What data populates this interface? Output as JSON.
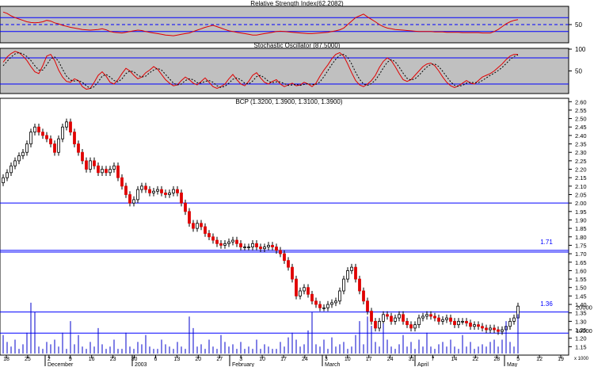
{
  "chart_data": [
    {
      "type": "line",
      "title": "Relative Strength Index(62.2082)",
      "ylim": [
        0,
        100
      ],
      "y_ticks": [
        50
      ],
      "levels": [
        70,
        50,
        30
      ],
      "series": [
        {
          "color": "#e00000",
          "values": [
            86,
            82,
            75,
            70,
            66,
            62,
            58,
            56,
            55,
            56,
            58,
            62,
            60,
            55,
            52,
            48,
            45,
            42,
            40,
            38,
            36,
            35,
            34,
            35,
            36,
            38,
            35,
            30,
            28,
            27,
            26,
            28,
            30,
            32,
            34,
            33,
            30,
            28,
            26,
            24,
            22,
            20,
            19,
            18,
            20,
            22,
            24,
            26,
            30,
            34,
            38,
            42,
            45,
            48,
            44,
            40,
            36,
            32,
            30,
            28,
            26,
            24,
            22,
            20,
            20,
            22,
            24,
            26,
            28,
            30,
            31,
            30,
            29,
            28,
            27,
            26,
            25,
            24,
            24,
            25,
            26,
            27,
            28,
            30,
            32,
            35,
            40,
            50,
            60,
            70,
            75,
            80,
            72,
            65,
            58,
            50,
            44,
            40,
            38,
            36,
            35,
            34,
            33,
            32,
            31,
            30,
            30,
            30,
            30,
            29,
            29,
            29,
            28,
            28,
            28,
            28,
            27,
            27,
            27,
            27,
            27,
            26,
            26,
            26,
            30,
            36,
            44,
            52,
            58,
            62,
            64
          ]
        }
      ]
    },
    {
      "type": "line",
      "title": "Stochastic Oscillator (87.5000)",
      "ylim": [
        0,
        100
      ],
      "y_ticks": [
        100,
        50
      ],
      "levels": [
        80,
        20
      ],
      "series": [
        {
          "color": "#e00000",
          "values": [
            70,
            82,
            90,
            95,
            92,
            84,
            74,
            60,
            48,
            44,
            62,
            84,
            88,
            74,
            52,
            36,
            26,
            24,
            32,
            28,
            14,
            8,
            10,
            24,
            40,
            48,
            38,
            24,
            20,
            30,
            44,
            56,
            50,
            40,
            32,
            36,
            46,
            52,
            60,
            54,
            42,
            30,
            22,
            16,
            18,
            28,
            36,
            30,
            22,
            18,
            26,
            34,
            24,
            14,
            10,
            14,
            20,
            32,
            42,
            30,
            20,
            16,
            26,
            40,
            46,
            34,
            24,
            20,
            26,
            30,
            20,
            14,
            18,
            22,
            16,
            18,
            24,
            20,
            14,
            22,
            38,
            52,
            64,
            78,
            88,
            92,
            84,
            66,
            46,
            28,
            18,
            14,
            20,
            28,
            40,
            58,
            72,
            80,
            74,
            60,
            44,
            30,
            26,
            30,
            40,
            50,
            60,
            66,
            68,
            62,
            50,
            36,
            24,
            16,
            12,
            16,
            22,
            28,
            22,
            20,
            28,
            36,
            40,
            44,
            50,
            58,
            66,
            76,
            84,
            88,
            88
          ]
        },
        {
          "color": "#000000",
          "dashed": true,
          "values": [
            62,
            72,
            82,
            89,
            92,
            89,
            83,
            74,
            62,
            52,
            52,
            64,
            78,
            82,
            72,
            54,
            38,
            29,
            27,
            28,
            24,
            16,
            10,
            14,
            25,
            38,
            42,
            36,
            28,
            25,
            32,
            44,
            50,
            48,
            40,
            36,
            38,
            46,
            52,
            56,
            52,
            42,
            32,
            22,
            18,
            20,
            28,
            32,
            30,
            23,
            22,
            26,
            28,
            24,
            16,
            12,
            15,
            22,
            31,
            34,
            30,
            22,
            20,
            27,
            37,
            40,
            34,
            26,
            23,
            25,
            25,
            21,
            17,
            18,
            19,
            17,
            19,
            21,
            19,
            19,
            25,
            37,
            51,
            65,
            77,
            86,
            88,
            81,
            66,
            47,
            31,
            20,
            17,
            21,
            29,
            42,
            57,
            70,
            76,
            71,
            59,
            45,
            33,
            29,
            32,
            40,
            50,
            59,
            65,
            66,
            60,
            49,
            37,
            25,
            17,
            15,
            17,
            22,
            24,
            23,
            23,
            28,
            34,
            40,
            45,
            51,
            58,
            67,
            76,
            83,
            87
          ]
        }
      ]
    },
    {
      "type": "candlestick",
      "title": "BCP (1.3200, 1.3900, 1.3100, 1.3900)",
      "ylim": [
        1.1,
        2.62
      ],
      "y_ticks": [
        "2.60",
        "2.55",
        "2.50",
        "2.45",
        "2.40",
        "2.35",
        "2.30",
        "2.25",
        "2.20",
        "2.15",
        "2.10",
        "2.05",
        "2.00",
        "1.95",
        "1.90",
        "1.85",
        "1.80",
        "1.75",
        "1.70",
        "1.65",
        "1.60",
        "1.55",
        "1.50",
        "1.45",
        "1.40",
        "1.35",
        "1.30",
        "1.25",
        "1.20",
        "1.15"
      ],
      "levels": [
        2.0,
        1.72,
        1.71,
        1.355,
        1.23
      ],
      "annotations": [
        {
          "text": "1.71",
          "value": 1.77
        },
        {
          "text": "1.36",
          "value": 1.405
        }
      ],
      "colors": {
        "up": "#ffffff",
        "down": "#e00000"
      },
      "closes": [
        2.15,
        2.18,
        2.22,
        2.25,
        2.28,
        2.3,
        2.35,
        2.42,
        2.45,
        2.42,
        2.4,
        2.38,
        2.35,
        2.3,
        2.38,
        2.45,
        2.48,
        2.42,
        2.35,
        2.3,
        2.25,
        2.2,
        2.25,
        2.22,
        2.18,
        2.2,
        2.18,
        2.2,
        2.22,
        2.15,
        2.1,
        2.05,
        2.0,
        2.02,
        2.08,
        2.1,
        2.08,
        2.06,
        2.07,
        2.08,
        2.06,
        2.05,
        2.06,
        2.08,
        2.06,
        2.0,
        1.95,
        1.88,
        1.85,
        1.88,
        1.86,
        1.82,
        1.8,
        1.78,
        1.76,
        1.75,
        1.76,
        1.77,
        1.78,
        1.76,
        1.74,
        1.74,
        1.74,
        1.76,
        1.74,
        1.73,
        1.74,
        1.75,
        1.74,
        1.72,
        1.7,
        1.66,
        1.62,
        1.55,
        1.45,
        1.48,
        1.5,
        1.46,
        1.42,
        1.4,
        1.38,
        1.38,
        1.4,
        1.41,
        1.42,
        1.48,
        1.55,
        1.6,
        1.62,
        1.55,
        1.48,
        1.42,
        1.36,
        1.3,
        1.26,
        1.3,
        1.34,
        1.33,
        1.3,
        1.32,
        1.34,
        1.3,
        1.28,
        1.26,
        1.28,
        1.32,
        1.33,
        1.34,
        1.33,
        1.32,
        1.3,
        1.31,
        1.32,
        1.3,
        1.28,
        1.3,
        1.3,
        1.29,
        1.27,
        1.28,
        1.27,
        1.26,
        1.25,
        1.26,
        1.25,
        1.24,
        1.25,
        1.27,
        1.3,
        1.32,
        1.39
      ],
      "categories": [
        "18",
        "25",
        "2",
        "9",
        "16",
        "23",
        "30",
        "6",
        "13",
        "20",
        "27",
        "3",
        "10",
        "17",
        "24",
        "3",
        "10",
        "17",
        "24",
        "31",
        "7",
        "14",
        "22",
        "28",
        "5",
        "12",
        "19"
      ],
      "period_labels": [
        "December",
        "2003",
        "February",
        "March",
        "April",
        "May"
      ],
      "volume": {
        "y_ticks": [
          "20000",
          "10000"
        ],
        "unit": "x 1000",
        "values": [
          8,
          5,
          3,
          6,
          2,
          4,
          9,
          22,
          18,
          3,
          2,
          5,
          4,
          6,
          3,
          9,
          2,
          14,
          4,
          8,
          3,
          2,
          5,
          3,
          11,
          4,
          2,
          3,
          6,
          2,
          2,
          9,
          3,
          2,
          5,
          4,
          8,
          3,
          2,
          2,
          6,
          4,
          3,
          2,
          5,
          3,
          2,
          16,
          11,
          3,
          4,
          2,
          6,
          3,
          2,
          8,
          5,
          3,
          4,
          2,
          5,
          2,
          3,
          2,
          6,
          2,
          4,
          3,
          2,
          2,
          5,
          3,
          7,
          9,
          6,
          3,
          4,
          10,
          18,
          4,
          3,
          6,
          2,
          7,
          3,
          4,
          5,
          2,
          3,
          8,
          14,
          4,
          16,
          12,
          5,
          3,
          13,
          6,
          3,
          2,
          4,
          8,
          3,
          5,
          2,
          6,
          3,
          9,
          3,
          2,
          4,
          5,
          3,
          6,
          3,
          2,
          8,
          3,
          5,
          2,
          3,
          4,
          3,
          5,
          6,
          3,
          6,
          14,
          5,
          3,
          17
        ]
      }
    }
  ]
}
